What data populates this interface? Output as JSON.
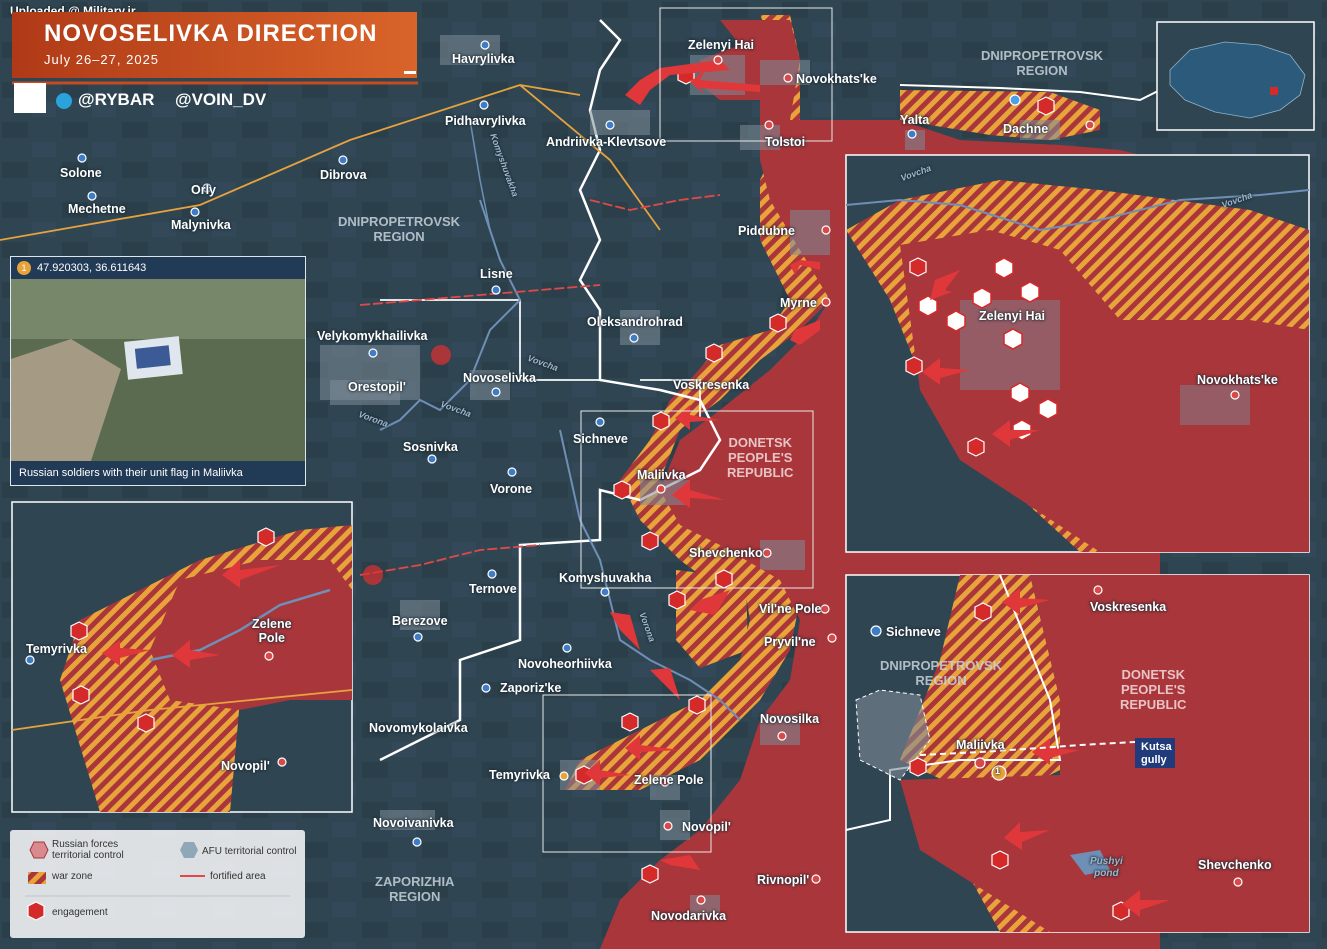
{
  "header": {
    "uploaded": "Uploaded @ Military.ir",
    "title": "NOVOSELIVKA DIRECTION",
    "date": "July 26–27, 2025",
    "social_rybar": "@RYBAR",
    "social_voin": "@VOIN_DV"
  },
  "colors": {
    "russian_control": "#a8363b",
    "war_zone_a": "#e8a33a",
    "war_zone_b": "#a8363b",
    "afu_background": "#2f4552",
    "header": "#c84a1e",
    "engagement": "#d42a2a"
  },
  "photo": {
    "marker": "1",
    "coordinates": "47.920303, 36.611643",
    "caption": "Russian soldiers with their unit flag in Maliivka"
  },
  "regions": {
    "dnipro_top": "DNIPROPETROVSK\nREGION",
    "dnipro_main": "DNIPROPETROVSK\nREGION",
    "donetsk_main": "DONETSK\nPEOPLE'S\nREPUBLIC",
    "zaporizhia": "ZAPORIZHIA\nREGION",
    "dnipro_inset": "DNIPROPETROVSK\nREGION",
    "donetsk_inset": "DONETSK\nPEOPLE'S\nREPUBLIC"
  },
  "settlements": {
    "havrylivka": "Havrylivka",
    "zelenyi_hai": "Zelenyi Hai",
    "novokhatske": "Novokhats'ke",
    "pidhavrylivka": "Pidhavrylivka",
    "andriivka": "Andriivka-Klevtsove",
    "tolstoi": "Tolstoi",
    "yalta": "Yalta",
    "dachne": "Dachne",
    "solone": "Solone",
    "orly": "Orly",
    "dibrova": "Dibrova",
    "mechetne": "Mechetne",
    "malynivka": "Malynivka",
    "piddubne": "Piddubne",
    "lisne": "Lisne",
    "myrne": "Myrne",
    "oleksandrohrad": "Oleksandrohrad",
    "velykomykhailivka": "Velykomykhailivka",
    "orestopil": "Orestopil'",
    "novoselivka": "Novoselivka",
    "voskresenka": "Voskresenka",
    "sichneve": "Sichneve",
    "sosnivka": "Sosnivka",
    "maliivka": "Maliivka",
    "vorone": "Vorone",
    "shevchenko": "Shevchenko",
    "komyshuvakha": "Komyshuvakha",
    "ternove": "Ternove",
    "vilne_pole": "Vil'ne Pole",
    "pryvilne": "Pryvil'ne",
    "berezove": "Berezove",
    "novoheorhiivka": "Novoheorhiivka",
    "zaporizke": "Zaporiz'ke",
    "novosilka": "Novosilka",
    "novomykolaivka": "Novomykolaivka",
    "temyrivka": "Temyrivka",
    "zelene_pole": "Zelene Pole",
    "novopil": "Novopil'",
    "novoivanivka": "Novoivanivka",
    "rivnopil": "Rivnopil'",
    "novodarivka": "Novodarivka"
  },
  "rivers": {
    "komyshuvakha": "Komyshuvakha",
    "vovcha": "Vovcha",
    "vovcha2": "Vovcha",
    "vorona": "Vorona",
    "vovcha_inset": "Vovcha",
    "vovcha_inset2": "Vovcha",
    "vorona2": "Vorona"
  },
  "inset_left": {
    "temyrivka": "Temyrivka",
    "zelene_pole": "Zelene\nPole",
    "novopil": "Novopil'"
  },
  "inset_top_right": {
    "zelenyi_hai": "Zelenyi Hai",
    "novokhatske": "Novokhats'ke",
    "vovcha": "Vovcha",
    "vovcha2": "Vovcha"
  },
  "inset_bottom_right": {
    "voskresenka": "Voskresenka",
    "sichneve": "Sichneve",
    "maliivka": "Maliivka",
    "kutsa_gully": "Kutsa\ngully",
    "pushyi_pond": "Pushyi\npond",
    "shevchenko": "Shevchenko",
    "marker": "1"
  },
  "legend": {
    "russian_forces": "Russian forces\nterritorial control",
    "afu": "AFU territorial control",
    "war_zone": "war zone",
    "fortified": "fortified area",
    "engagement": "engagement"
  }
}
